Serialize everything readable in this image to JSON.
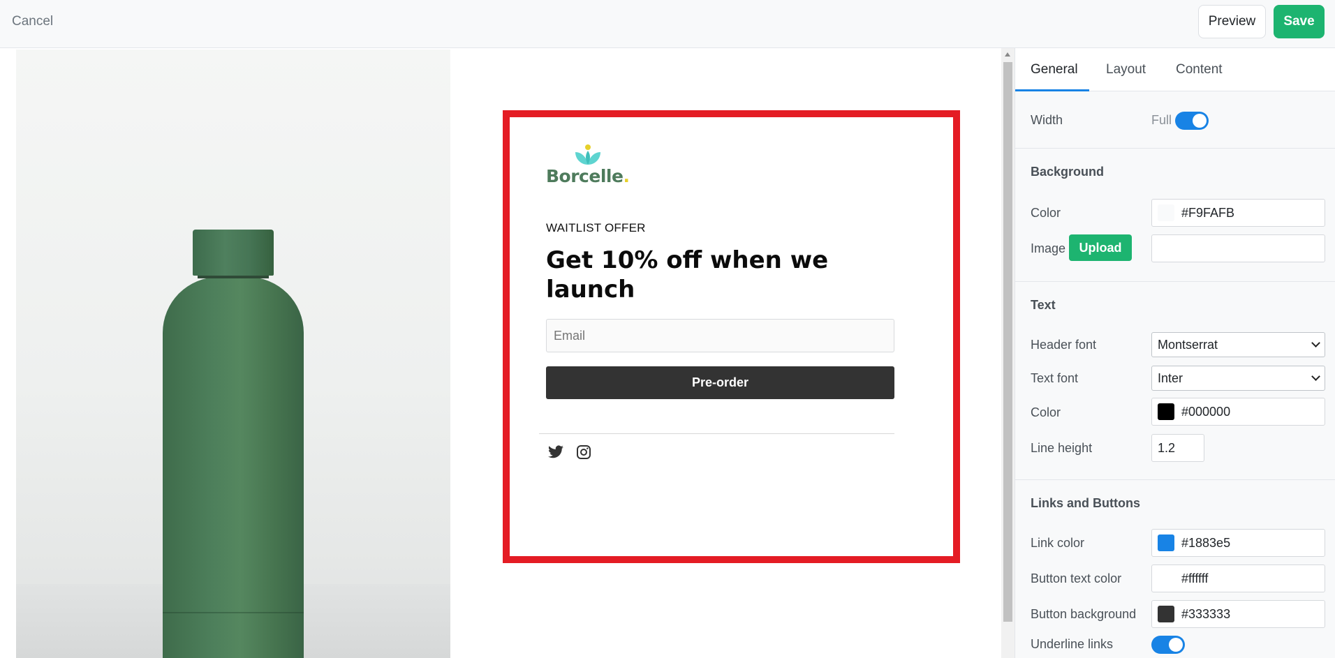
{
  "topbar": {
    "cancel_label": "Cancel",
    "preview_label": "Preview",
    "save_label": "Save"
  },
  "popup": {
    "logo_text": "Borcelle",
    "logo_dot": ".",
    "eyebrow": "WAITLIST OFFER",
    "headline": "Get 10% off when we launch",
    "email_placeholder": "Email",
    "button_label": "Pre-order",
    "social_icons": [
      "twitter-icon",
      "instagram-icon"
    ]
  },
  "panel": {
    "tabs": [
      {
        "label": "General",
        "active": true
      },
      {
        "label": "Layout",
        "active": false
      },
      {
        "label": "Content",
        "active": false
      }
    ],
    "width": {
      "label": "Width",
      "value": "Full",
      "enabled": true
    },
    "background": {
      "heading": "Background",
      "color_label": "Color",
      "color_value": "#F9FAFB",
      "image_label": "Image",
      "upload_label": "Upload",
      "image_value": ""
    },
    "text": {
      "heading": "Text",
      "header_font_label": "Header font",
      "header_font_value": "Montserrat",
      "text_font_label": "Text font",
      "text_font_value": "Inter",
      "color_label": "Color",
      "color_value": "#000000",
      "line_height_label": "Line height",
      "line_height_value": "1.2"
    },
    "links": {
      "heading": "Links and Buttons",
      "link_color_label": "Link color",
      "link_color_value": "#1883e5",
      "button_text_color_label": "Button text color",
      "button_text_color_value": "#ffffff",
      "button_background_label": "Button background",
      "button_background_value": "#333333",
      "underline_label": "Underline links",
      "underline_enabled": true
    }
  },
  "colors": {
    "accent_green": "#1db470",
    "toggle_blue": "#1883e5",
    "popup_border": "#e41c24",
    "button_dark": "#333333",
    "logo_green": "#4e7b5c"
  }
}
